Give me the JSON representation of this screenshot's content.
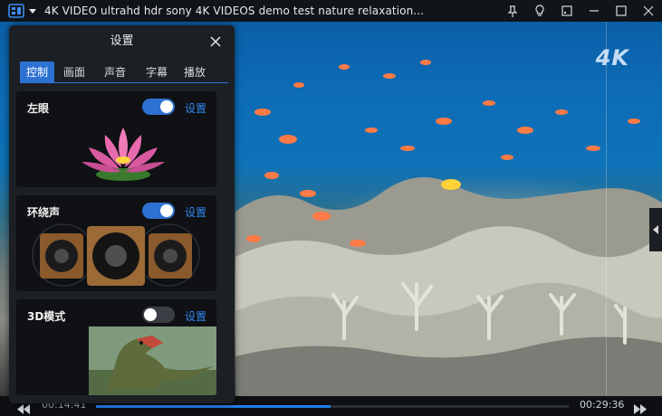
{
  "window": {
    "title": "4K VIDEO ultrahd hdr sony 4K VIDEOS demo test nature relaxation..."
  },
  "video": {
    "watermark": "4K"
  },
  "playback": {
    "current_time": "00:14:41",
    "total_time": "00:29:36",
    "progress": 0.496
  },
  "settings_panel": {
    "title": "设置",
    "tabs": [
      {
        "label": "控制",
        "active": true
      },
      {
        "label": "画面",
        "active": false
      },
      {
        "label": "声音",
        "active": false
      },
      {
        "label": "字幕",
        "active": false
      },
      {
        "label": "播放",
        "active": false
      }
    ],
    "cards": [
      {
        "label": "左眼",
        "enabled": true,
        "link": "设置",
        "art": "lotus-flower"
      },
      {
        "label": "环绕声",
        "enabled": true,
        "link": "设置",
        "art": "speakers"
      },
      {
        "label": "3D模式",
        "enabled": false,
        "link": "设置",
        "art": "dinosaur"
      }
    ]
  },
  "colors": {
    "accent": "#2d72d2",
    "link": "#2d86ea",
    "panel_bg": "#1c1f24"
  }
}
